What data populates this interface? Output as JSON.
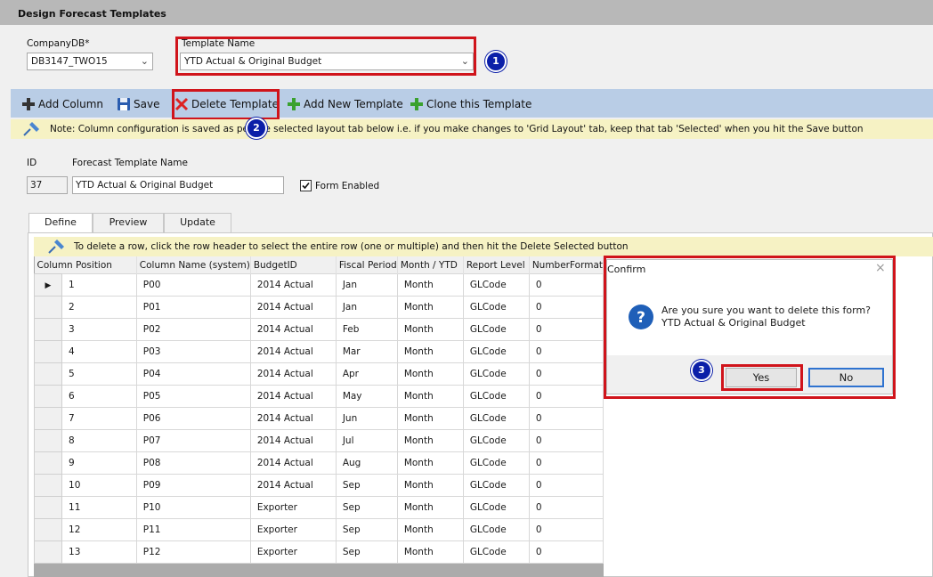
{
  "header": {
    "title": "Design Forecast Templates"
  },
  "company": {
    "label": "CompanyDB*",
    "value": "DB3147_TWO15"
  },
  "template": {
    "label": "Template Name",
    "value": "YTD Actual & Original Budget"
  },
  "toolbar": {
    "add_column": "Add Column",
    "save": "Save",
    "delete_template": "Delete Template",
    "add_new_template": "Add New Template",
    "clone_template": "Clone this Template"
  },
  "note": "Note: Column configuration is saved as per the selected layout tab below i.e. if you make changes to 'Grid Layout' tab, keep that tab 'Selected' when you hit the Save button",
  "form": {
    "id_label": "ID",
    "id_value": "37",
    "name_label": "Forecast Template Name",
    "name_value": "YTD Actual & Original Budget",
    "enabled_label": "Form Enabled",
    "enabled_checked": true
  },
  "tabs": [
    "Define",
    "Preview",
    "Update"
  ],
  "grid_note": "To delete a row, click the row header to select the entire row (one or multiple) and then hit the Delete Selected button",
  "grid": {
    "columns": [
      "Column Position",
      "Column Name (system)",
      "BudgetID",
      "Fiscal Period",
      "Month / YTD",
      "Report Level",
      "NumberFormat"
    ],
    "rows": [
      [
        "1",
        "P00",
        "2014 Actual",
        "Jan",
        "Month",
        "GLCode",
        "0"
      ],
      [
        "2",
        "P01",
        "2014 Actual",
        "Jan",
        "Month",
        "GLCode",
        "0"
      ],
      [
        "3",
        "P02",
        "2014 Actual",
        "Feb",
        "Month",
        "GLCode",
        "0"
      ],
      [
        "4",
        "P03",
        "2014 Actual",
        "Mar",
        "Month",
        "GLCode",
        "0"
      ],
      [
        "5",
        "P04",
        "2014 Actual",
        "Apr",
        "Month",
        "GLCode",
        "0"
      ],
      [
        "6",
        "P05",
        "2014 Actual",
        "May",
        "Month",
        "GLCode",
        "0"
      ],
      [
        "7",
        "P06",
        "2014 Actual",
        "Jun",
        "Month",
        "GLCode",
        "0"
      ],
      [
        "8",
        "P07",
        "2014 Actual",
        "Jul",
        "Month",
        "GLCode",
        "0"
      ],
      [
        "9",
        "P08",
        "2014 Actual",
        "Aug",
        "Month",
        "GLCode",
        "0"
      ],
      [
        "10",
        "P09",
        "2014 Actual",
        "Sep",
        "Month",
        "GLCode",
        "0"
      ],
      [
        "11",
        "P10",
        "Exporter",
        "Sep",
        "Month",
        "GLCode",
        "0"
      ],
      [
        "12",
        "P11",
        "Exporter",
        "Sep",
        "Month",
        "GLCode",
        "0"
      ],
      [
        "13",
        "P12",
        "Exporter",
        "Sep",
        "Month",
        "GLCode",
        "0"
      ]
    ]
  },
  "dialog": {
    "title": "Confirm",
    "message_line1": "Are you sure you want to delete this form?",
    "message_line2": "YTD Actual & Original Budget",
    "yes": "Yes",
    "no": "No"
  },
  "callouts": [
    "1",
    "2",
    "3"
  ],
  "colors": {
    "highlight": "#d0141b",
    "badge": "#0b1fa8",
    "toolbar": "#b9cde6",
    "note": "#f6f2c4"
  }
}
